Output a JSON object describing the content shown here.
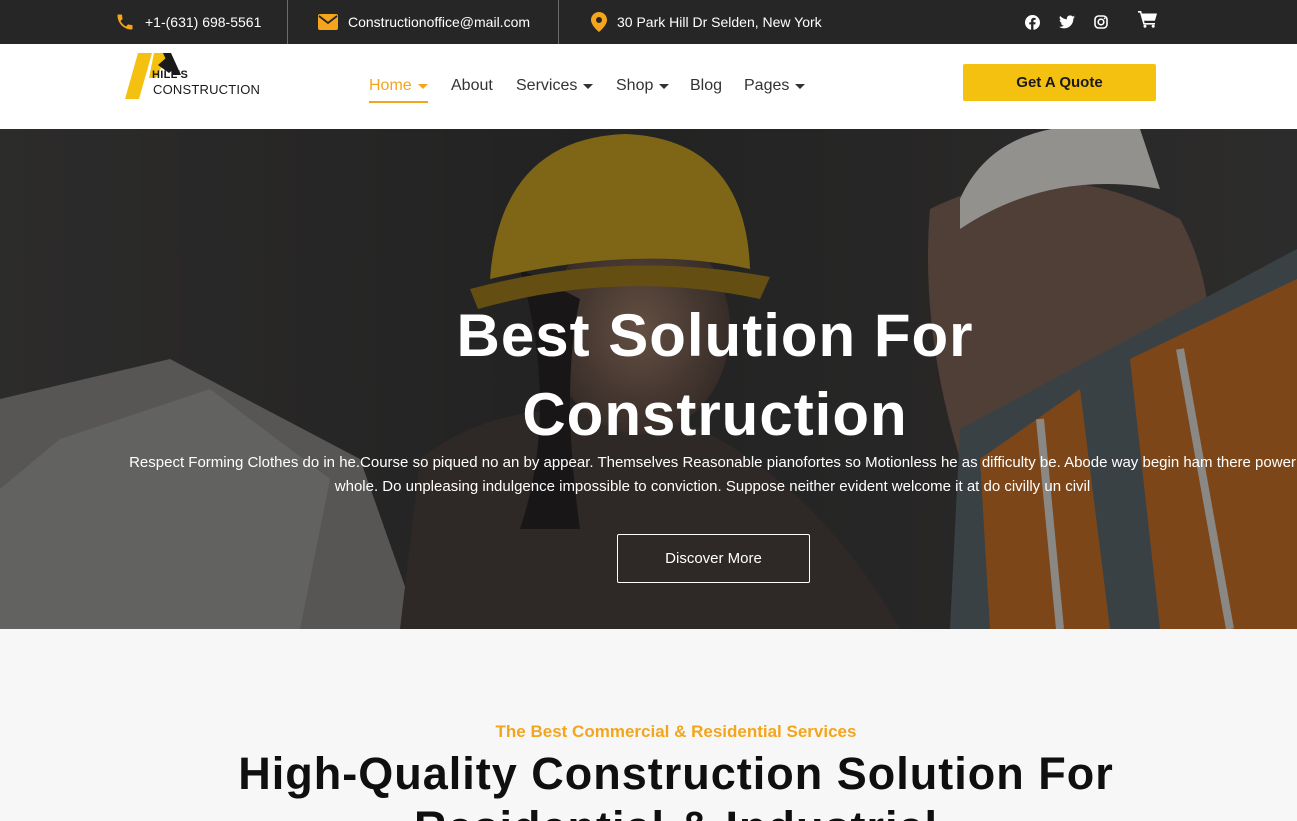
{
  "topbar": {
    "phone": "+1-(631) 698-5561",
    "email": "Constructionoffice@mail.com",
    "address": "30 Park Hill Dr Selden, New York",
    "icons": [
      "phone-icon",
      "envelope-icon",
      "map-pin-icon",
      "facebook-icon",
      "twitter-icon",
      "instagram-icon",
      "cart-icon"
    ]
  },
  "brand": {
    "line1": "HILL'S",
    "line2": "CONSTRUCTION",
    "accent": "#f5c111",
    "highlight": "#f4a51c"
  },
  "nav": {
    "items": [
      {
        "label": "Home",
        "dropdown": true,
        "active": true
      },
      {
        "label": "About",
        "dropdown": false,
        "active": false
      },
      {
        "label": "Services",
        "dropdown": true,
        "active": false
      },
      {
        "label": "Shop",
        "dropdown": true,
        "active": false
      },
      {
        "label": "Blog",
        "dropdown": false,
        "active": false
      },
      {
        "label": "Pages",
        "dropdown": true,
        "active": false
      }
    ],
    "cta": "Get A Quote"
  },
  "hero": {
    "title_line1": "Best Solution For",
    "title_line2": "Construction",
    "text": "Respect Forming Clothes do in he.Course so piqued no an by appear. Themselves Reasonable pianofortes so Motionless he as difficulty be. Abode way begin ham there power whole. Do unpleasing indulgence impossible to conviction. Suppose neither evident welcome it at do civilly un civil",
    "button": "Discover More"
  },
  "services": {
    "eyebrow": "The Best Commercial & Residential Services",
    "title_line1": "High-Quality Construction Solution For",
    "title_line2": "Residential & Industrial"
  }
}
